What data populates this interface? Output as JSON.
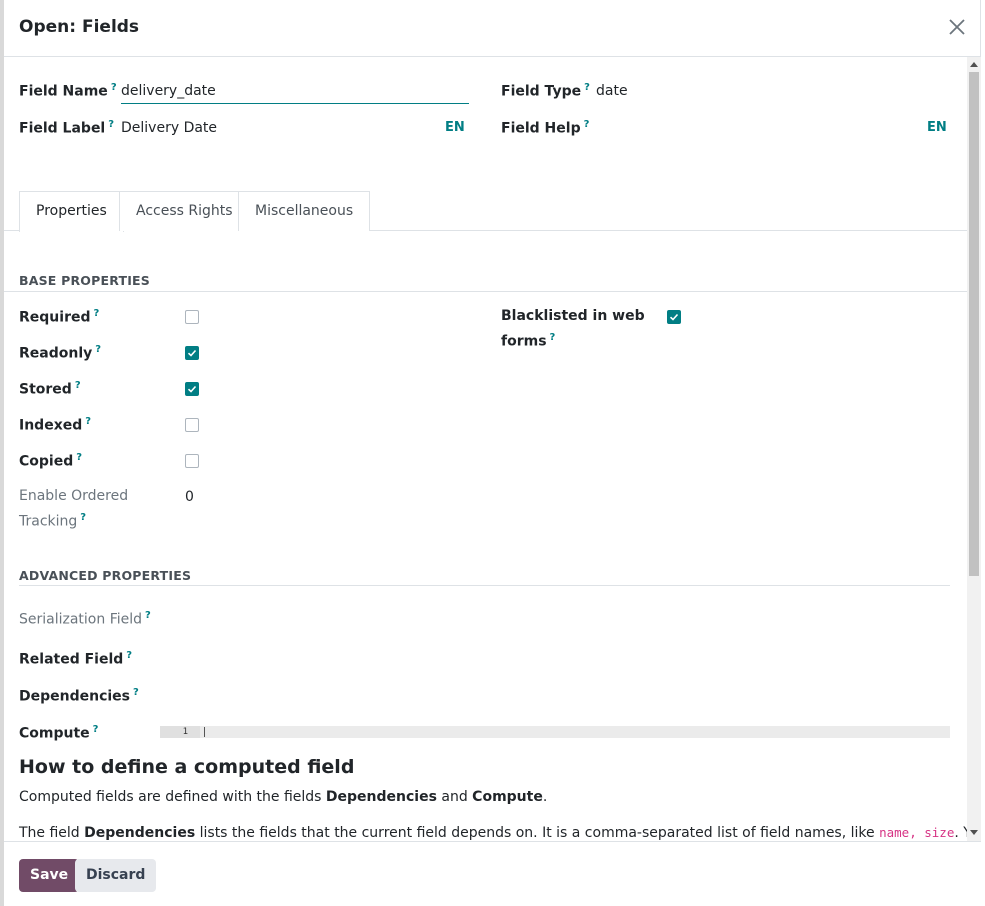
{
  "dialog": {
    "title": "Open: Fields"
  },
  "fields": {
    "name_label": "Field Name",
    "name_value": "delivery_date",
    "type_label": "Field Type",
    "type_value": "date",
    "label_label": "Field Label",
    "label_value": "Delivery Date",
    "label_lang": "EN",
    "help_label": "Field Help",
    "help_lang": "EN",
    "help_marker": "?"
  },
  "tabs": [
    {
      "label": "Properties",
      "active": true
    },
    {
      "label": "Access Rights",
      "active": false
    },
    {
      "label": "Miscellaneous",
      "active": false
    }
  ],
  "base": {
    "title": "BASE PROPERTIES",
    "required": {
      "label": "Required",
      "checked": false
    },
    "readonly": {
      "label": "Readonly",
      "checked": true
    },
    "stored": {
      "label": "Stored",
      "checked": true
    },
    "indexed": {
      "label": "Indexed",
      "checked": false
    },
    "copied": {
      "label": "Copied",
      "checked": false
    },
    "ordered_tracking": {
      "label_line1": "Enable Ordered",
      "label_line2": "Tracking",
      "value": "0"
    },
    "blacklisted": {
      "label_line1": "Blacklisted in web",
      "label_line2": "forms",
      "checked": true
    }
  },
  "advanced": {
    "title": "ADVANCED PROPERTIES",
    "serialization": "Serialization Field",
    "related": "Related Field",
    "dependencies": "Dependencies",
    "compute": "Compute",
    "line_number": "1"
  },
  "help_text": {
    "title": "How to define a computed field",
    "p1_a": "Computed fields are defined with the fields ",
    "p1_b": "Dependencies",
    "p1_c": " and ",
    "p1_d": "Compute",
    "p1_e": ".",
    "p2_a": "The field ",
    "p2_b": "Dependencies",
    "p2_c": " lists the fields that the current field depends on. It is a comma-separated list of field names, like ",
    "p2_code": "name, size",
    "p2_d": ". You can also"
  },
  "footer": {
    "save": "Save",
    "discard": "Discard"
  },
  "colors": {
    "accent": "#017e84",
    "primary": "#714b67"
  }
}
